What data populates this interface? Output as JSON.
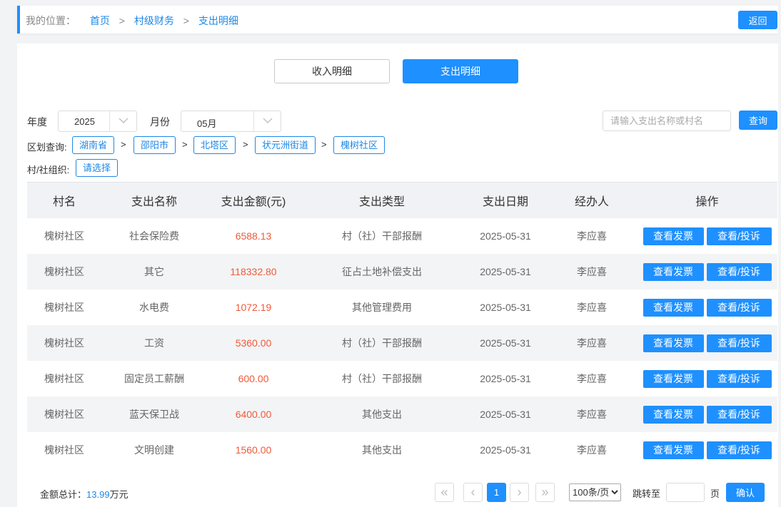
{
  "breadcrumb": {
    "label": "我的位置：",
    "items": [
      "首页",
      "村级财务",
      "支出明细"
    ],
    "separator": ">"
  },
  "back_button": "返回",
  "tabs": {
    "income": "收入明细",
    "expense": "支出明细"
  },
  "filters": {
    "year_label": "年度",
    "year_value": "2025",
    "month_label": "月份",
    "month_value": "05月",
    "search_placeholder": "请输入支出名称或村名",
    "search_value": "",
    "query_button": "查询",
    "region_label": "区划查询:",
    "regions": [
      "湖南省",
      "邵阳市",
      "北塔区",
      "状元洲街道",
      "槐树社区"
    ],
    "region_separator": ">",
    "org_label": "村/社组织:",
    "org_select": "请选择"
  },
  "table": {
    "headers": [
      "村名",
      "支出名称",
      "支出金额(元)",
      "支出类型",
      "支出日期",
      "经办人",
      "操作"
    ],
    "rows": [
      {
        "village": "槐树社区",
        "name": "社会保险费",
        "amount": "6588.13",
        "type": "村（社）干部报酬",
        "date": "2025-05-31",
        "handler": "李应喜"
      },
      {
        "village": "槐树社区",
        "name": "其它",
        "amount": "118332.80",
        "type": "征占土地补偿支出",
        "date": "2025-05-31",
        "handler": "李应喜"
      },
      {
        "village": "槐树社区",
        "name": "水电费",
        "amount": "1072.19",
        "type": "其他管理费用",
        "date": "2025-05-31",
        "handler": "李应喜"
      },
      {
        "village": "槐树社区",
        "name": "工资",
        "amount": "5360.00",
        "type": "村（社）干部报酬",
        "date": "2025-05-31",
        "handler": "李应喜"
      },
      {
        "village": "槐树社区",
        "name": "固定员工薪酬",
        "amount": "600.00",
        "type": "村（社）干部报酬",
        "date": "2025-05-31",
        "handler": "李应喜"
      },
      {
        "village": "槐树社区",
        "name": "蓝天保卫战",
        "amount": "6400.00",
        "type": "其他支出",
        "date": "2025-05-31",
        "handler": "李应喜"
      },
      {
        "village": "槐树社区",
        "name": "文明创建",
        "amount": "1560.00",
        "type": "其他支出",
        "date": "2025-05-31",
        "handler": "李应喜"
      }
    ],
    "action_invoice": "查看发票",
    "action_view": "查看/投诉"
  },
  "footer": {
    "total_label": "金额总计：",
    "total_value": "13.99",
    "total_unit": "万元",
    "current_page": "1",
    "page_size": "100条/页",
    "page_size_options": [
      "100条/页"
    ],
    "jump_label": "跳转至",
    "page_label": "页",
    "confirm_button": "确认"
  },
  "colors": {
    "accent": "#1e90ff",
    "amount": "#f05a3a",
    "link": "#1e88e5"
  }
}
